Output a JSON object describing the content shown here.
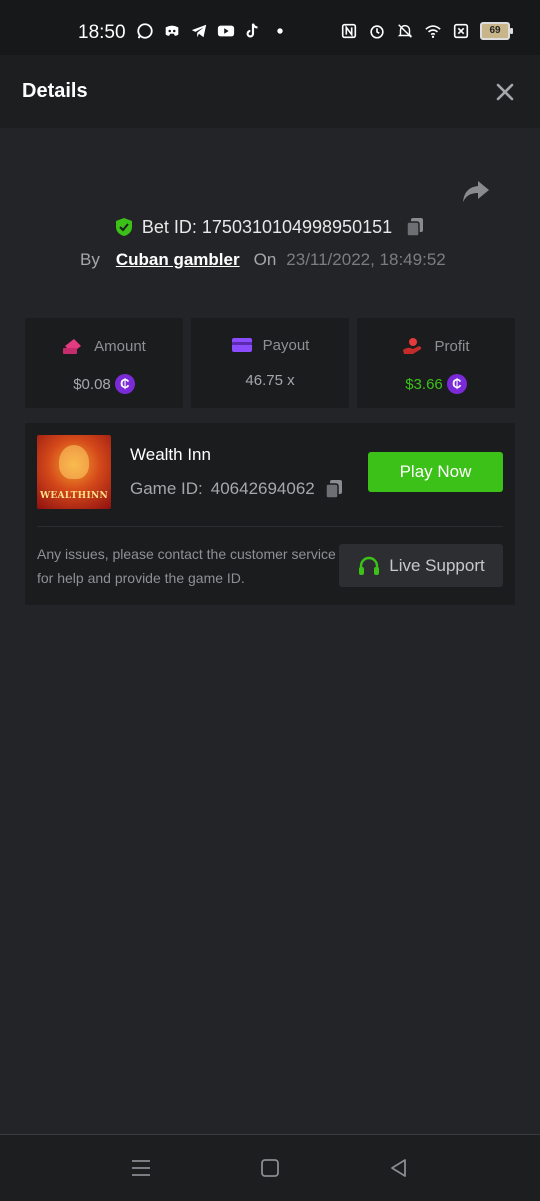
{
  "status_bar": {
    "time": "18:50",
    "battery": "69",
    "left_icons": [
      "whatsapp-icon",
      "discord-icon",
      "telegram-icon",
      "youtube-icon",
      "tiktok-icon",
      "dot-icon"
    ],
    "right_icons": [
      "nfc-icon",
      "alarm-icon",
      "mute-icon",
      "wifi-icon",
      "sim-off-icon",
      "battery-icon"
    ]
  },
  "header": {
    "title": "Details"
  },
  "bet": {
    "id_label": "Bet ID:",
    "id": "1750310104998950151",
    "by_label": "By",
    "user": "Cuban gambler",
    "on_label": "On",
    "date": "23/11/2022, 18:49:52"
  },
  "stats": {
    "amount": {
      "label": "Amount",
      "value": "$0.08"
    },
    "payout": {
      "label": "Payout",
      "value": "46.75 x"
    },
    "profit": {
      "label": "Profit",
      "value": "$3.66"
    }
  },
  "game": {
    "thumb_text": "WEALTHINN",
    "name": "Wealth Inn",
    "id_label": "Game ID:",
    "id": "40642694062",
    "play_label": "Play Now",
    "help_text": "Any issues, please contact the customer service for help and provide the game ID.",
    "support_label": "Live Support"
  },
  "colors": {
    "background": "#232427",
    "card": "#1b1c1e",
    "accent_green": "#3bc117",
    "coin_purple": "#7a2ad6"
  }
}
